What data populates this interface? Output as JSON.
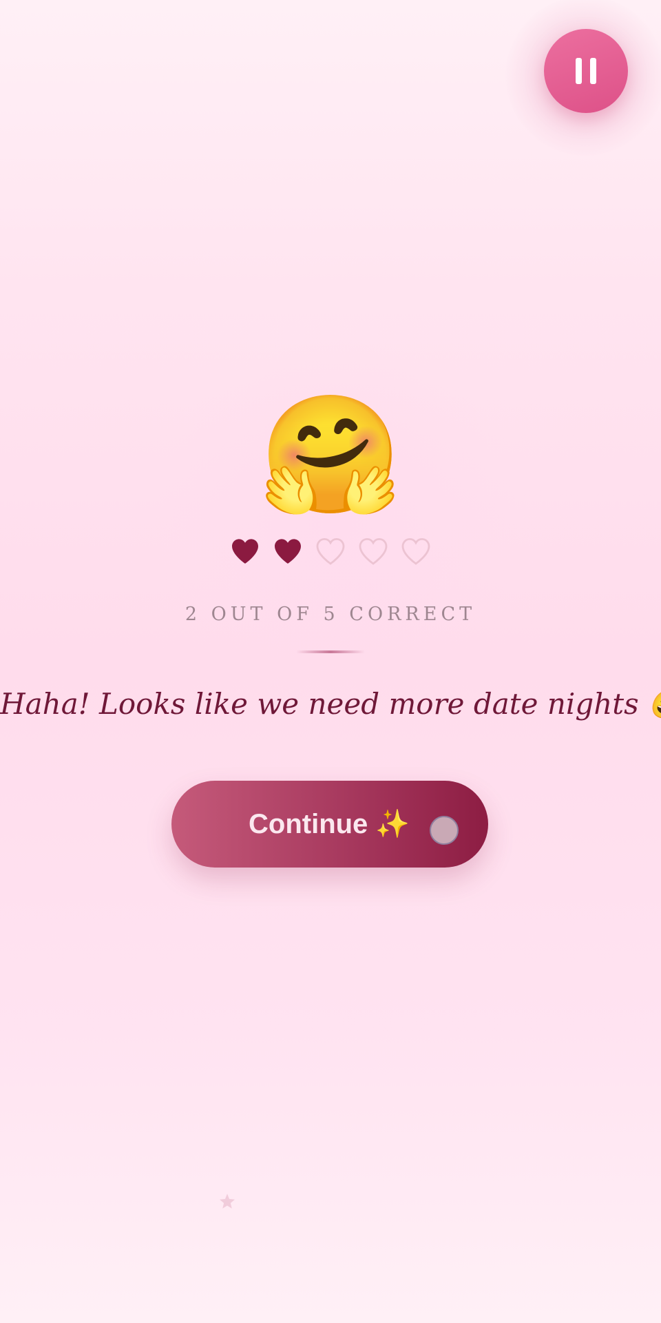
{
  "controls": {
    "pause_icon": "pause-icon"
  },
  "result": {
    "emoji": "🤗",
    "hearts": [
      {
        "filled": true
      },
      {
        "filled": true
      },
      {
        "filled": false
      },
      {
        "filled": false
      },
      {
        "filled": false
      }
    ],
    "correct": 2,
    "total": 5,
    "score_text": "2 OUT OF 5 CORRECT",
    "message": "Haha! Looks like we need more date nights 😄"
  },
  "actions": {
    "continue_label": "Continue ✨"
  },
  "colors": {
    "heart_filled": "#8b1a40",
    "heart_empty": "#ecc3d2",
    "pause_button": "#e35e92",
    "button_start": "#c55a7a",
    "button_end": "#8d1d43",
    "message_text": "#6f1838"
  }
}
